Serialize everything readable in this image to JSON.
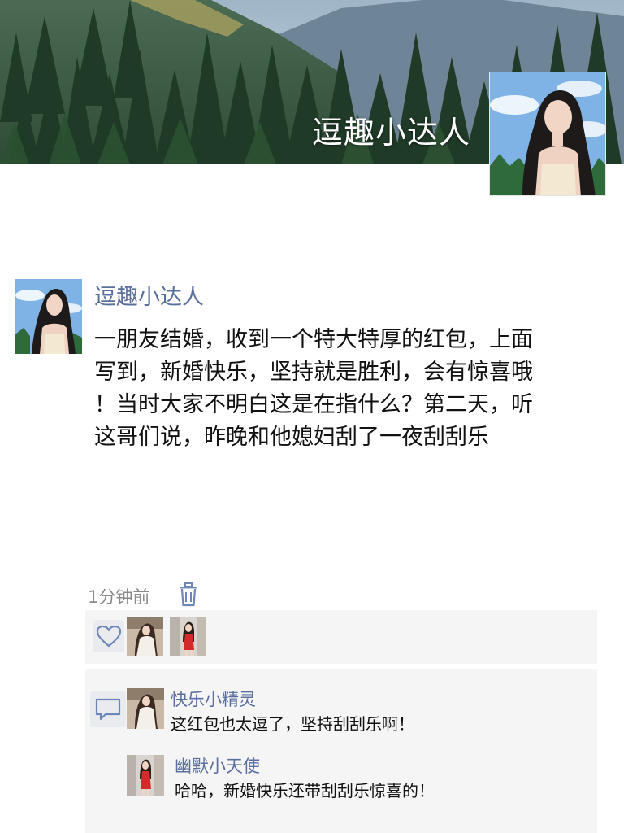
{
  "cover": {
    "display_name": "逗趣小达人",
    "background": "forest-mountain-photo",
    "avatar": "profile-photo-woman"
  },
  "post": {
    "author": "逗趣小达人",
    "avatar": "profile-photo-woman",
    "lines": [
      "一朋友结婚，收到一个特大特厚的红包，上面",
      "写到，新婚快乐，坚持就是胜利，会有惊喜哦",
      "！当时大家不明白这是在指什么？第二天，听",
      "这哥们说，昨晚和他媳妇刮了一夜刮刮乐"
    ],
    "time": "1分钟前",
    "delete_icon": "trash-icon"
  },
  "likes": {
    "icon": "heart-icon",
    "avatars": [
      "liker-avatar-white-dress",
      "liker-avatar-red-dress"
    ]
  },
  "comments": {
    "icon": "comment-bubble-icon",
    "items": [
      {
        "name": "快乐小精灵",
        "text": "这红包也太逗了，坚持刮刮乐啊！",
        "avatar": "avatar-white-dress"
      },
      {
        "name": "幽默小天使",
        "text": "哈哈，新婚快乐还带刮刮乐惊喜的！",
        "avatar": "avatar-red-dress"
      }
    ]
  },
  "colors": {
    "link_blue": "#5b6f9f",
    "panel_gray": "#f5f5f5",
    "icon_blue": "#6f86b8"
  }
}
